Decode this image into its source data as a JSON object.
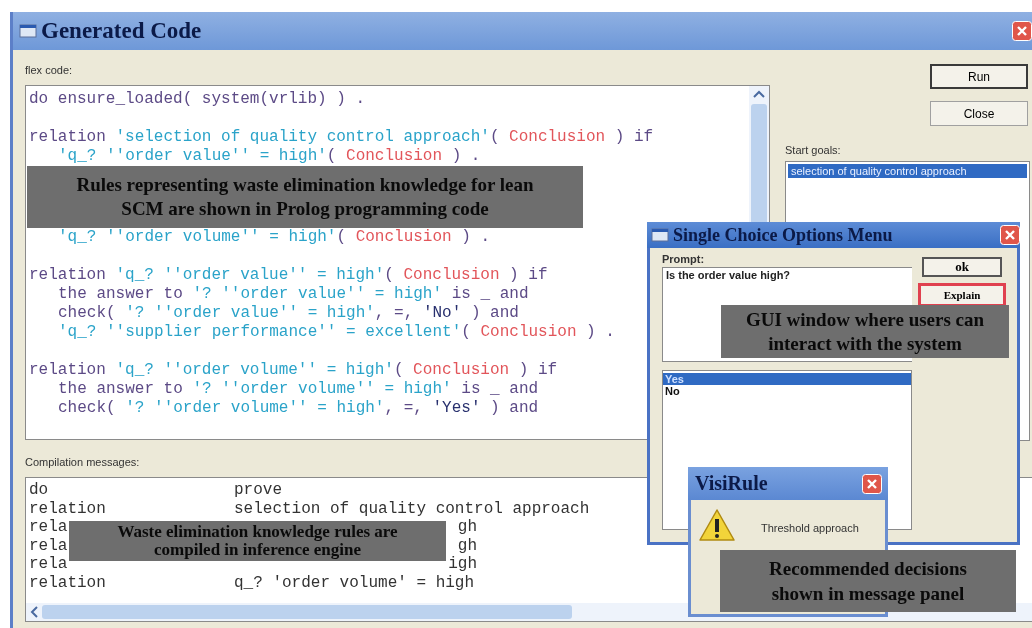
{
  "window": {
    "title": "Generated Code"
  },
  "code_editor": {
    "label": "flex code:",
    "lines": [
      {
        "kind": "code",
        "indent": false,
        "gap_before": false,
        "segments": [
          {
            "kind": "kw",
            "text": "do ensure_loaded( system(vrlib) ) ."
          }
        ]
      },
      {
        "kind": "code",
        "indent": false,
        "gap_before": true,
        "segments": [
          {
            "kind": "kw",
            "text": "relation "
          },
          {
            "kind": "str",
            "text": "'selection of quality control approach'"
          },
          {
            "kind": "kw",
            "text": "( "
          },
          {
            "kind": "var",
            "text": "Conclusion"
          },
          {
            "kind": "kw",
            "text": " ) if"
          }
        ]
      },
      {
        "kind": "code",
        "indent": true,
        "gap_before": false,
        "segments": [
          {
            "kind": "str",
            "text": "'q_? ''order value'' = high'"
          },
          {
            "kind": "kw",
            "text": "( "
          },
          {
            "kind": "var",
            "text": "Conclusion"
          },
          {
            "kind": "kw",
            "text": " ) ."
          }
        ]
      },
      {
        "kind": "callout",
        "text": "Rules representing waste elimination knowledge for lean SCM are shown in Prolog programming code"
      },
      {
        "kind": "code",
        "indent": true,
        "gap_before": false,
        "segments": [
          {
            "kind": "str",
            "text": "'q_? ''order volume'' = high'"
          },
          {
            "kind": "kw",
            "text": "( "
          },
          {
            "kind": "var",
            "text": "Conclusion"
          },
          {
            "kind": "kw",
            "text": " ) ."
          }
        ]
      },
      {
        "kind": "code",
        "indent": false,
        "gap_before": true,
        "segments": [
          {
            "kind": "kw",
            "text": "relation "
          },
          {
            "kind": "str",
            "text": "'q_? ''order value'' = high'"
          },
          {
            "kind": "kw",
            "text": "( "
          },
          {
            "kind": "var",
            "text": "Conclusion"
          },
          {
            "kind": "kw",
            "text": " ) if"
          }
        ]
      },
      {
        "kind": "code",
        "indent": true,
        "gap_before": false,
        "segments": [
          {
            "kind": "kw",
            "text": "the answer to "
          },
          {
            "kind": "str",
            "text": "'? ''order value'' = high'"
          },
          {
            "kind": "kw",
            "text": " is _ and"
          }
        ]
      },
      {
        "kind": "code",
        "indent": true,
        "gap_before": false,
        "segments": [
          {
            "kind": "kw",
            "text": "check( "
          },
          {
            "kind": "str",
            "text": "'? ''order value'' = high'"
          },
          {
            "kind": "kw",
            "text": ", =, "
          },
          {
            "kind": "lit",
            "text": "'No'"
          },
          {
            "kind": "kw",
            "text": " ) and"
          }
        ]
      },
      {
        "kind": "code",
        "indent": true,
        "gap_before": false,
        "segments": [
          {
            "kind": "str",
            "text": "'q_? ''supplier performance'' = excellent'"
          },
          {
            "kind": "kw",
            "text": "( "
          },
          {
            "kind": "var",
            "text": "Conclusion"
          },
          {
            "kind": "kw",
            "text": " ) ."
          }
        ]
      },
      {
        "kind": "code",
        "indent": false,
        "gap_before": true,
        "segments": [
          {
            "kind": "kw",
            "text": "relation "
          },
          {
            "kind": "str",
            "text": "'q_? ''order volume'' = high'"
          },
          {
            "kind": "kw",
            "text": "( "
          },
          {
            "kind": "var",
            "text": "Conclusion"
          },
          {
            "kind": "kw",
            "text": " ) if"
          }
        ]
      },
      {
        "kind": "code",
        "indent": true,
        "gap_before": false,
        "segments": [
          {
            "kind": "kw",
            "text": "the answer to "
          },
          {
            "kind": "str",
            "text": "'? ''order volume'' = high'"
          },
          {
            "kind": "kw",
            "text": " is _ and"
          }
        ]
      },
      {
        "kind": "code",
        "indent": true,
        "gap_before": false,
        "segments": [
          {
            "kind": "kw",
            "text": "check( "
          },
          {
            "kind": "str",
            "text": "'? ''order volume'' = high'"
          },
          {
            "kind": "kw",
            "text": ", =, "
          },
          {
            "kind": "lit",
            "text": "'Yes'"
          },
          {
            "kind": "kw",
            "text": " ) and"
          }
        ]
      }
    ]
  },
  "buttons": [
    {
      "label": "Run",
      "default": true
    },
    {
      "label": "Close",
      "default": false
    }
  ],
  "start_goals": {
    "label": "Start goals:",
    "items": [
      {
        "text": "selection of quality control approach",
        "selected": true
      }
    ]
  },
  "compilation": {
    "label": "Compilation messages:",
    "rows": [
      {
        "kind": "full",
        "col_1": "do",
        "col_2": "prove"
      },
      {
        "kind": "full",
        "col_1": "relation",
        "col_2": "selection of quality control approach"
      },
      {
        "kind": "clipped",
        "col_1": "rela",
        "col_2": "gh"
      },
      {
        "kind": "clipped",
        "col_1": "rela",
        "col_2": "gh"
      },
      {
        "kind": "clipped",
        "col_1": "rela",
        "col_2": "igh"
      },
      {
        "kind": "full",
        "col_1": "relation",
        "col_2": "q_? 'order volume' = high"
      }
    ],
    "callout": {
      "text": "Waste elimination knowledge rules are compiled in inference engine"
    }
  },
  "choice_dialog": {
    "title": "Single Choice Options Menu",
    "prompt_label": "Prompt:",
    "prompt": "Is the order value high?",
    "options": [
      {
        "text": "Yes",
        "selected": true
      },
      {
        "text": "No",
        "selected": false
      }
    ],
    "buttons": [
      {
        "label": "ok",
        "highlighted": false
      },
      {
        "label": "Explain",
        "highlighted": true
      }
    ],
    "callout": {
      "text": "GUI window where users can interact with the system"
    }
  },
  "message_dialog": {
    "title": "VisiRule",
    "message": "Threshold approach",
    "callout": {
      "text": "Recommended decisions shown in message panel"
    }
  }
}
